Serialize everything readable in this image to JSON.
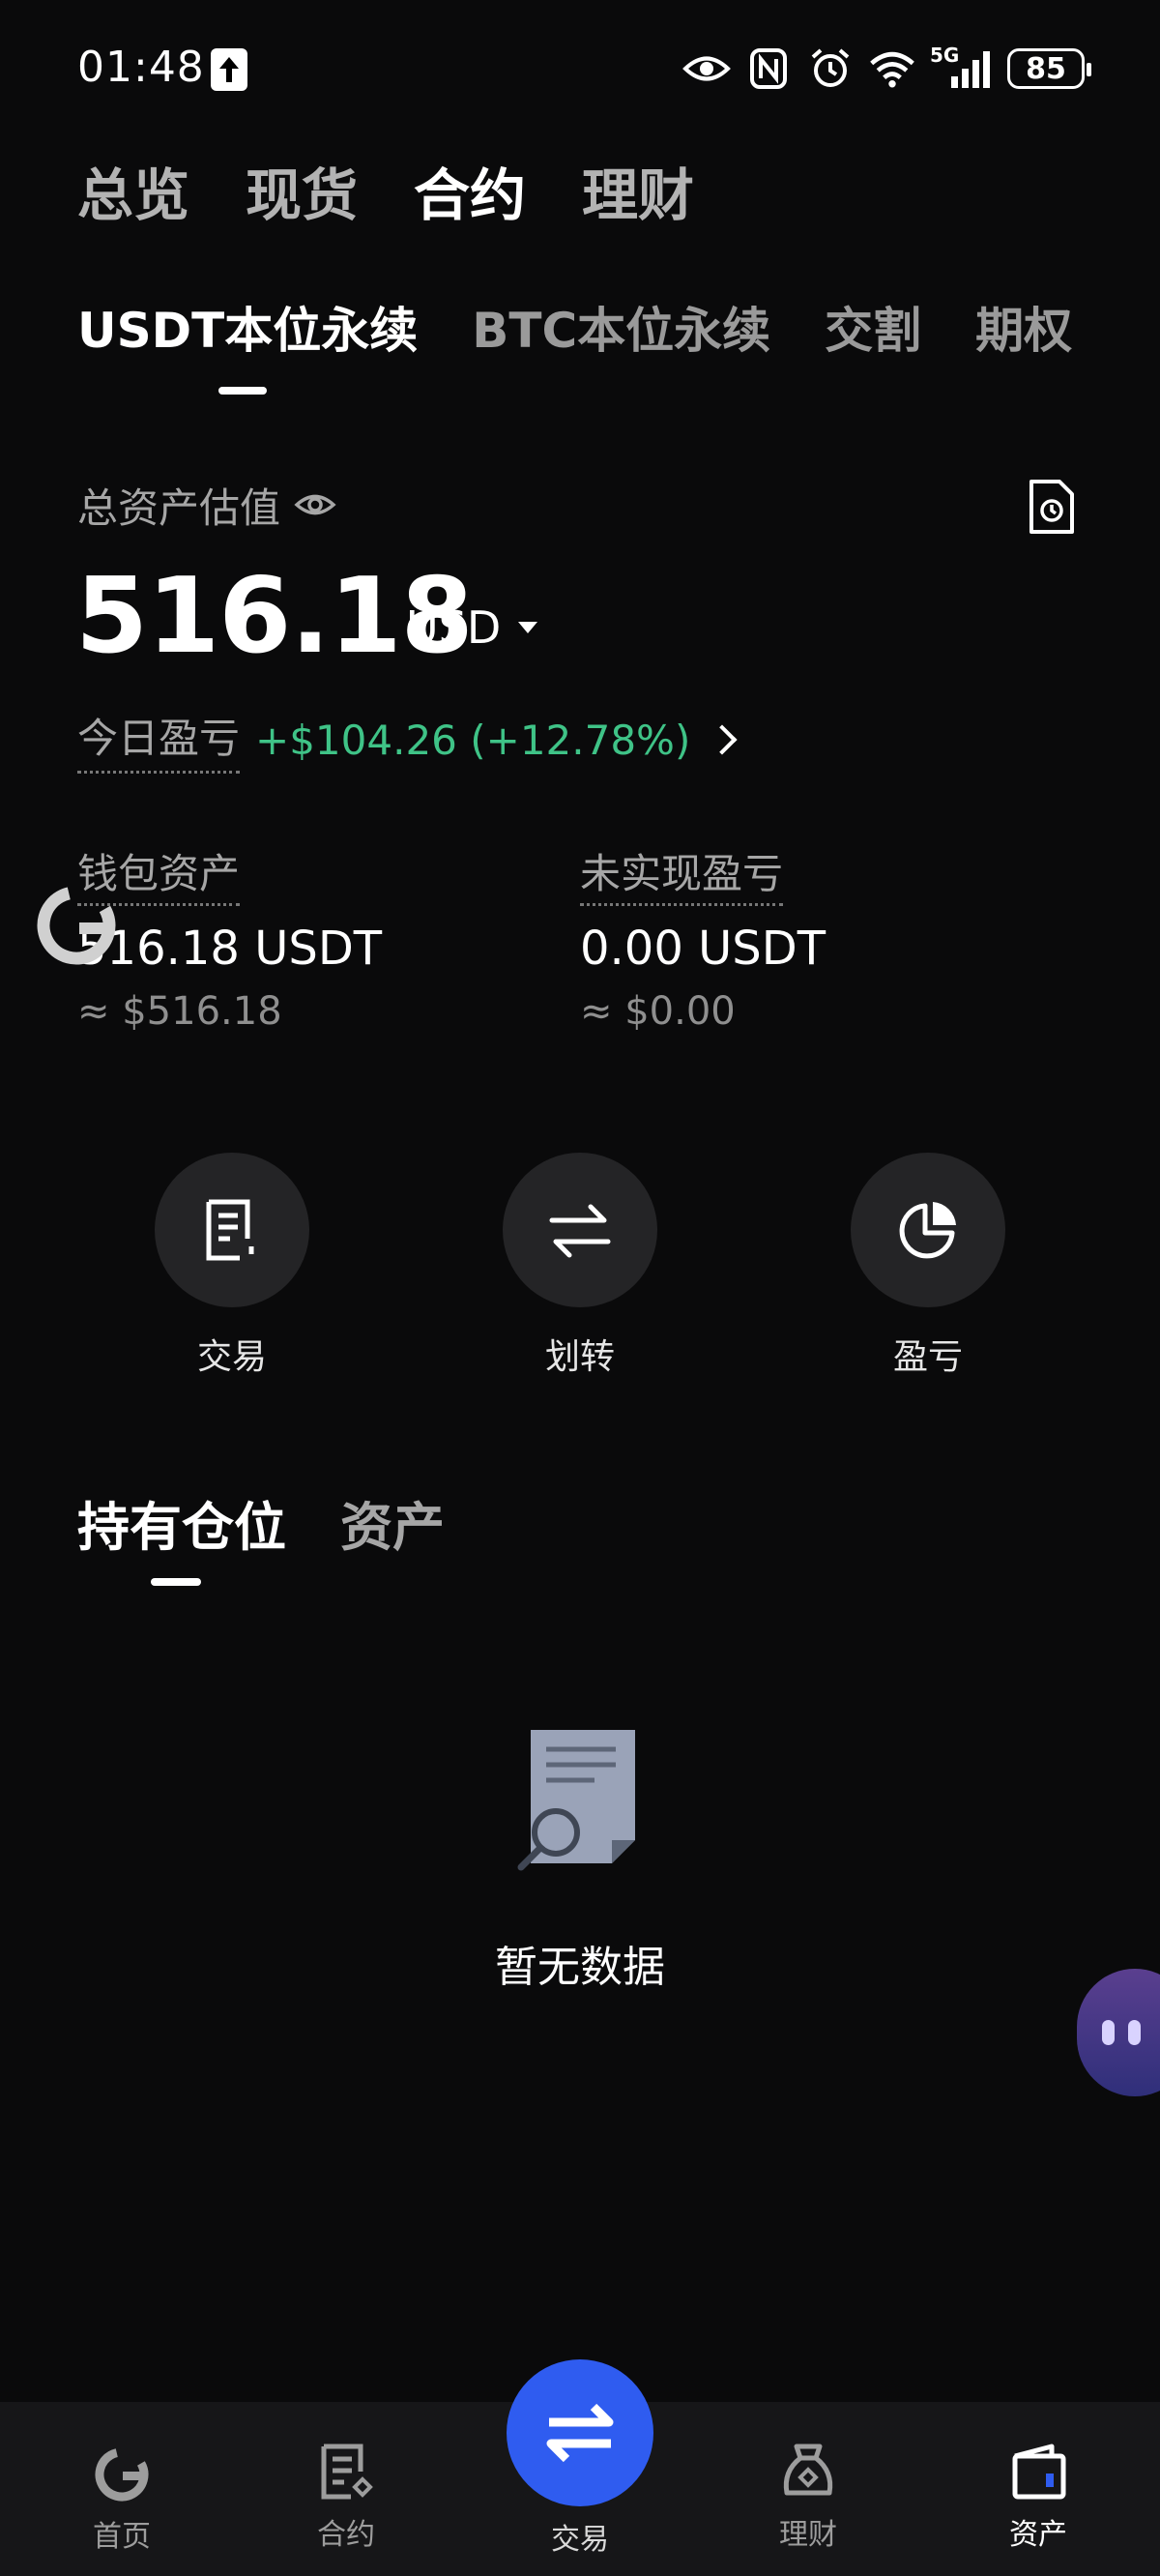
{
  "status_bar": {
    "time": "01:48",
    "network_label": "5G",
    "battery": "85"
  },
  "top_tabs": [
    {
      "label": "总览",
      "active": false
    },
    {
      "label": "现货",
      "active": false
    },
    {
      "label": "合约",
      "active": true
    },
    {
      "label": "理财",
      "active": false
    }
  ],
  "sub_tabs": [
    {
      "label": "USDT本位永续",
      "active": true
    },
    {
      "label": "BTC本位永续",
      "active": false
    },
    {
      "label": "交割",
      "active": false
    },
    {
      "label": "期权",
      "active": false
    }
  ],
  "summary": {
    "total_label": "总资产估值",
    "total_value": "516.18",
    "currency": "USD",
    "pnl_label": "今日盈亏",
    "pnl_value": "+$104.26 (+12.78%)"
  },
  "wallet": {
    "label": "钱包资产",
    "value": "516.18 USDT",
    "approx": "≈ $516.18"
  },
  "unrealized": {
    "label": "未实现盈亏",
    "value": "0.00 USDT",
    "approx": "≈ $0.00"
  },
  "actions": [
    {
      "label": "交易",
      "icon": "order-document-icon"
    },
    {
      "label": "划转",
      "icon": "transfer-arrows-icon"
    },
    {
      "label": "盈亏",
      "icon": "pie-chart-icon"
    }
  ],
  "position_tabs": [
    {
      "label": "持有仓位",
      "active": true
    },
    {
      "label": "资产",
      "active": false
    }
  ],
  "empty_state": {
    "text": "暂无数据"
  },
  "bottom_nav": [
    {
      "label": "首页",
      "icon": "home-logo-icon",
      "active": false
    },
    {
      "label": "合约",
      "icon": "contract-icon",
      "active": false
    },
    {
      "label": "交易",
      "icon": "trade-swap-icon",
      "active": false
    },
    {
      "label": "理财",
      "icon": "finance-pot-icon",
      "active": false
    },
    {
      "label": "资产",
      "icon": "wallet-icon",
      "active": true
    }
  ],
  "colors": {
    "background": "#0a0a0b",
    "profit_green": "#3fc387",
    "accent_blue": "#2f5cf0"
  }
}
